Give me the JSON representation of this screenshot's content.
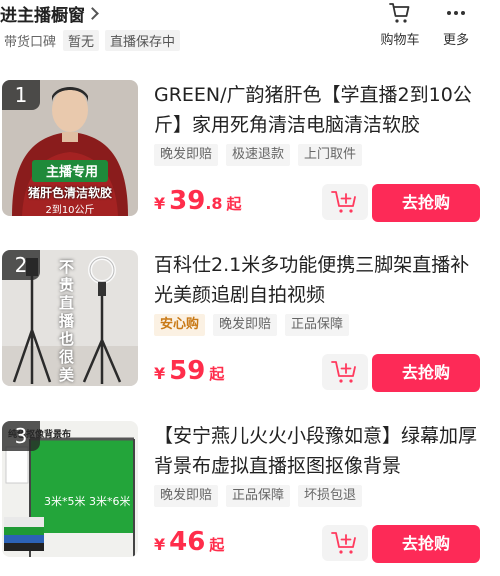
{
  "header": {
    "store_title": "进主播橱窗",
    "reputation_label": "带货口碑",
    "reputation_value": "暂无",
    "live_save_label": "直播保存中",
    "cart_label": "购物车",
    "more_label": "更多"
  },
  "items": [
    {
      "rank": "1",
      "title": "GREEN/广韵猪肝色【学直播2到10公斤】家用死角清洁电脑清洁软胶",
      "tags": [
        "晚发即赔",
        "极速退款",
        "上门取件"
      ],
      "price_currency": "¥",
      "price_int": "39",
      "price_dec": ".8",
      "price_suffix": "起",
      "thumb_banner": "主播专用",
      "thumb_caption": "猪肝色清洁软胶",
      "thumb_sub": "2到10公斤",
      "buy_label": "去抢购"
    },
    {
      "rank": "2",
      "title": "百科仕2.1米多功能便携三脚架直播补光美颜追剧自拍视频",
      "tags": [
        "安心购",
        "晚发即赔",
        "正品保障"
      ],
      "price_currency": "¥",
      "price_int": "59",
      "price_dec": "",
      "price_suffix": "起",
      "thumb_vertical": "不贵直播也很美",
      "buy_label": "去抢购"
    },
    {
      "rank": "3",
      "title": "【安宁燕儿火火小段豫如意】绿幕加厚背景布虚拟直播抠图抠像背景",
      "tags": [
        "晚发即赔",
        "正品保障",
        "坏损包退"
      ],
      "price_currency": "¥",
      "price_int": "46",
      "price_dec": "",
      "price_suffix": "起",
      "thumb_title": "纯色抠像背景布",
      "thumb_size": "3米*5米 3米*6米",
      "buy_label": "去抢购"
    }
  ],
  "colors": {
    "price": "#ff2d4b",
    "buy_button": "#fd2a57",
    "special_tag": "#c97a17"
  }
}
